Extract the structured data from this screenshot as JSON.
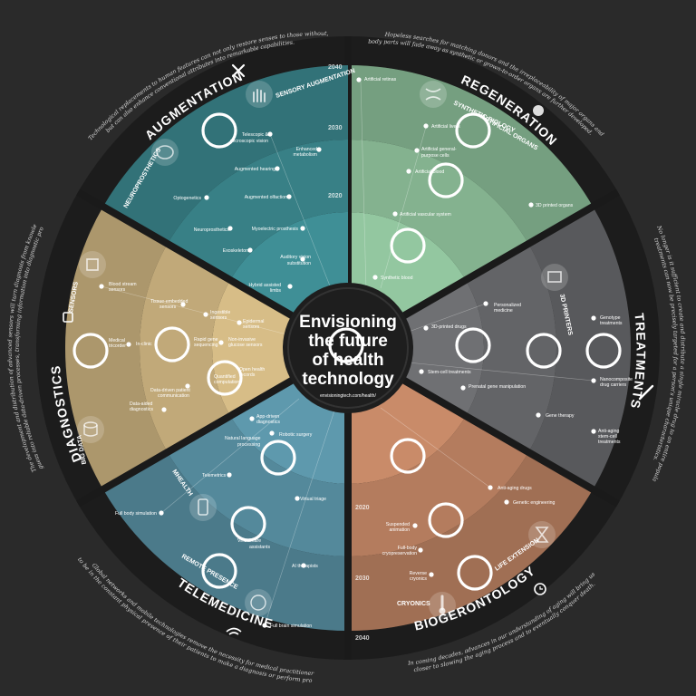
{
  "center": {
    "title_lines": [
      "Envisioning",
      "the future",
      "of health",
      "technology"
    ],
    "url": "envisioningtech.com/health/"
  },
  "colors": {
    "background": "#2a2a2a",
    "ring": "#1a1a1a",
    "augmentation": "#3f8f96",
    "regeneration": "#93c7a0",
    "treatments": "#6f7073",
    "biogerontology": "#c98b69",
    "telemedicine": "#5e99ad",
    "diagnostics": "#d7bd87"
  },
  "years": {
    "left": [
      "2040",
      "2030",
      "2020"
    ],
    "right": [
      "2020",
      "2030",
      "2040"
    ]
  },
  "sections": {
    "augmentation": {
      "title": "AUGMENTATION",
      "description": [
        "Technological replacements to human features can not only restore senses to those without,",
        "but can also enhance conventional attributes into remarkable capabilities."
      ],
      "subcategories": [
        "SENSORY AUGMENTATION",
        "NEUROPROSTHETICS"
      ],
      "labels": [
        {
          "text": "Telescopic &",
          "icon": "dot"
        },
        {
          "text": "microscopic vision"
        },
        {
          "text": "Enhanced"
        },
        {
          "text": "metabolism"
        },
        {
          "text": "Augmented hearing"
        },
        {
          "text": "Optogenetics"
        },
        {
          "text": "Augmented olfaction"
        },
        {
          "text": "Neuroprosthetics"
        },
        {
          "text": "Myoelectric prosthesis"
        },
        {
          "text": "Exoskeleton"
        },
        {
          "text": "Auditory vision"
        },
        {
          "text": "substitution"
        },
        {
          "text": "Hybrid assisted"
        },
        {
          "text": "limbs"
        }
      ]
    },
    "regeneration": {
      "title": "REGENERATION",
      "description": [
        "Hopeless searches for matching donors and the irreplaceability of major organs and",
        "body parts will fade away as synthetic or grown-to-order organs are further developed."
      ],
      "subcategories": [
        "SYNTHETIC BIOLOGY",
        "ARTIFICIAL ORGANS"
      ],
      "labels": [
        {
          "text": "Artificial retinas"
        },
        {
          "text": "Artificial livers"
        },
        {
          "text": "Artificial general-"
        },
        {
          "text": "purpose cells"
        },
        {
          "text": "Artificial blood"
        },
        {
          "text": "3D printed organs"
        },
        {
          "text": "Artificial vascular system"
        },
        {
          "text": "Synthetic blood"
        }
      ]
    },
    "treatments": {
      "title": "TREATMENTS",
      "description": [
        "No longer is it sufficient to create and distribute a single miracle drug to an entire population—",
        "treatments can now be precisely targeted for a person's unique characteristics."
      ],
      "subcategories": [
        "3D PRINTERS"
      ],
      "labels": [
        {
          "text": "Personalized"
        },
        {
          "text": "medicine"
        },
        {
          "text": "3D-printed drugs"
        },
        {
          "text": "Genotype"
        },
        {
          "text": "treatments"
        },
        {
          "text": "Stem-cell treatments"
        },
        {
          "text": "Nanocomposite"
        },
        {
          "text": "drug carriers"
        },
        {
          "text": "Prenatal gene manipulation"
        },
        {
          "text": "Gene therapy"
        },
        {
          "text": "Anti-aging"
        },
        {
          "text": "stem-cell"
        },
        {
          "text": "treatments"
        }
      ]
    },
    "biogerontology": {
      "title": "BIOGERONTOLOGY",
      "description": [
        "In coming decades, advances in our understanding of aging will bring us",
        "closer to slowing the aging process and to eventually conquer death."
      ],
      "subcategories": [
        "LIFE EXTENSION",
        "CRYONICS"
      ],
      "labels": [
        {
          "text": "Anti-aging drugs"
        },
        {
          "text": "Genetic engineering"
        },
        {
          "text": "Suspended"
        },
        {
          "text": "animation"
        },
        {
          "text": "Full-body"
        },
        {
          "text": "cryopreservation"
        },
        {
          "text": "Reverse"
        },
        {
          "text": "cryonics"
        }
      ]
    },
    "telemedicine": {
      "title": "TELEMEDICINE",
      "description": [
        "Global networks and mobile technologies remove the necessity for medical practitioners",
        "to be in the constant physical presence of their patients to make a diagnosis or perform procedures."
      ],
      "subcategories": [
        "MHEALTH",
        "REMOTE PRESENCE"
      ],
      "labels": [
        {
          "text": "App-driven"
        },
        {
          "text": "diagnostics"
        },
        {
          "text": "Natural language"
        },
        {
          "text": "processing"
        },
        {
          "text": "Robotic surgery"
        },
        {
          "text": "Telemetrics"
        },
        {
          "text": "Virtual triage"
        },
        {
          "text": "Full body simulation"
        },
        {
          "text": "Virtual care"
        },
        {
          "text": "assistants"
        },
        {
          "text": "AI therapists"
        },
        {
          "text": "Full brain simulation"
        }
      ]
    },
    "diagnostics": {
      "title": "DIAGNOSTICS",
      "description": [
        "The development and distribution of advanced sensors will turn diagnosis from knowledgeable",
        "guess into reliable data-driven processes, transforming information into diagnostic procedures."
      ],
      "subcategories": [
        "SENSORS",
        "BIG DATA"
      ],
      "labels": [
        {
          "text": "Blood stream"
        },
        {
          "text": "sensors"
        },
        {
          "text": "Tissue-embedded"
        },
        {
          "text": "sensors"
        },
        {
          "text": "Ingestible"
        },
        {
          "text": "sensors"
        },
        {
          "text": "Epidermal"
        },
        {
          "text": "sensors"
        },
        {
          "text": "Medical"
        },
        {
          "text": "tricorder"
        },
        {
          "text": "In-clinic"
        },
        {
          "text": "Rapid gene"
        },
        {
          "text": "sequencing"
        },
        {
          "text": "Non-invasive"
        },
        {
          "text": "glucose sensors"
        },
        {
          "text": "Quantified"
        },
        {
          "text": "computation"
        },
        {
          "text": "Open health"
        },
        {
          "text": "records"
        },
        {
          "text": "Data-driven patient"
        },
        {
          "text": "communication"
        },
        {
          "text": "Data-aided"
        },
        {
          "text": "diagnostics"
        }
      ]
    }
  }
}
